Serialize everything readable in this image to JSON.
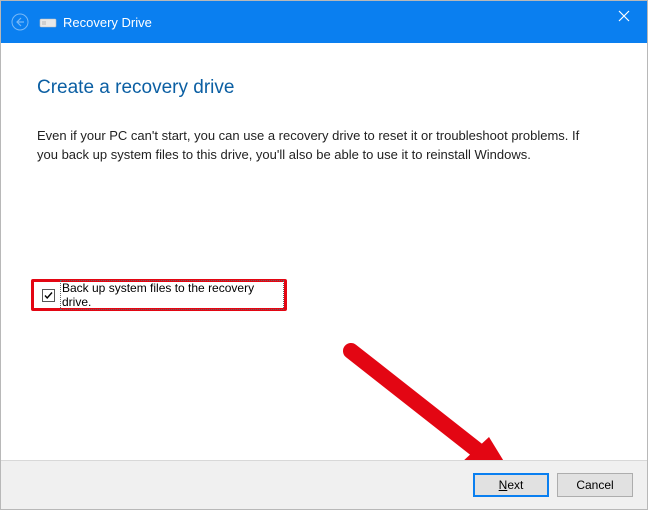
{
  "titlebar": {
    "title": "Recovery Drive"
  },
  "page": {
    "heading": "Create a recovery drive",
    "description": "Even if your PC can't start, you can use a recovery drive to reset it or troubleshoot problems. If you back up system files to this drive, you'll also be able to use it to reinstall Windows."
  },
  "checkbox": {
    "label": "Back up system files to the recovery drive.",
    "checked": true
  },
  "buttons": {
    "next_prefix": "N",
    "next_rest": "ext",
    "cancel": "Cancel"
  }
}
